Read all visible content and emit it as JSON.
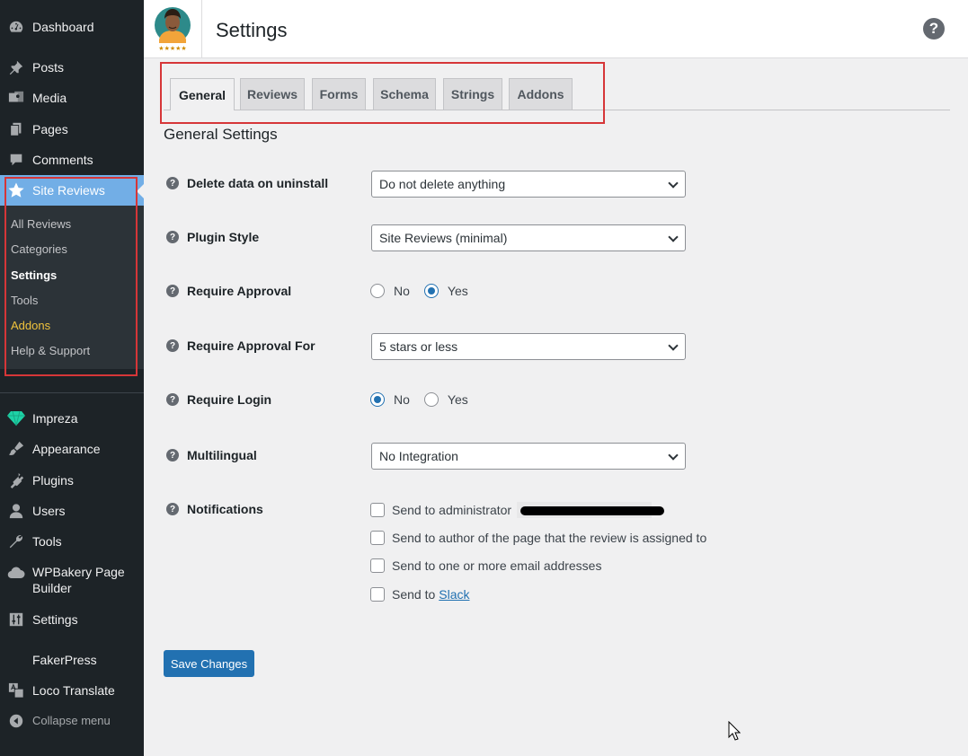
{
  "sidebar": {
    "items": [
      {
        "label": "Dashboard",
        "icon": "dashboard-icon"
      },
      {
        "label": "Posts",
        "icon": "pin-icon"
      },
      {
        "label": "Media",
        "icon": "media-icon"
      },
      {
        "label": "Pages",
        "icon": "pages-icon"
      },
      {
        "label": "Comments",
        "icon": "comment-icon"
      },
      {
        "label": "Site Reviews",
        "icon": "star-icon",
        "active": true
      },
      {
        "label": "Impreza",
        "icon": "diamond-icon"
      },
      {
        "label": "Appearance",
        "icon": "brush-icon"
      },
      {
        "label": "Plugins",
        "icon": "plugin-icon"
      },
      {
        "label": "Users",
        "icon": "user-icon"
      },
      {
        "label": "Tools",
        "icon": "wrench-icon"
      },
      {
        "label": "WPBakery Page Builder",
        "icon": "cloud-icon"
      },
      {
        "label": "Settings",
        "icon": "sliders-icon"
      },
      {
        "label": "FakerPress",
        "icon": ""
      },
      {
        "label": "Loco Translate",
        "icon": "translate-icon"
      },
      {
        "label": "Collapse menu",
        "icon": "collapse-icon"
      }
    ],
    "submenu": [
      "All Reviews",
      "Categories",
      "Settings",
      "Tools",
      "Addons",
      "Help & Support"
    ],
    "accent_color": "#72aee6",
    "addon_color": "#f0c33c"
  },
  "header": {
    "title": "Settings",
    "help_icon": "?"
  },
  "tabs": [
    "General",
    "Reviews",
    "Forms",
    "Schema",
    "Strings",
    "Addons"
  ],
  "section_title": "General Settings",
  "fields": {
    "delete_data": {
      "label": "Delete data on uninstall",
      "value": "Do not delete anything"
    },
    "plugin_style": {
      "label": "Plugin Style",
      "value": "Site Reviews (minimal)"
    },
    "require_approval": {
      "label": "Require Approval",
      "options": [
        "No",
        "Yes"
      ],
      "selected": "Yes"
    },
    "require_approval_for": {
      "label": "Require Approval For",
      "value": "5 stars or less"
    },
    "require_login": {
      "label": "Require Login",
      "options": [
        "No",
        "Yes"
      ],
      "selected": "No"
    },
    "multilingual": {
      "label": "Multilingual",
      "value": "No Integration"
    },
    "notifications": {
      "label": "Notifications",
      "options": [
        "Send to administrator",
        "Send to author of the page that the review is assigned to",
        "Send to one or more email addresses",
        "Send to"
      ],
      "slack_link": "Slack"
    }
  },
  "save_label": "Save Changes",
  "primary_color": "#2271b1"
}
